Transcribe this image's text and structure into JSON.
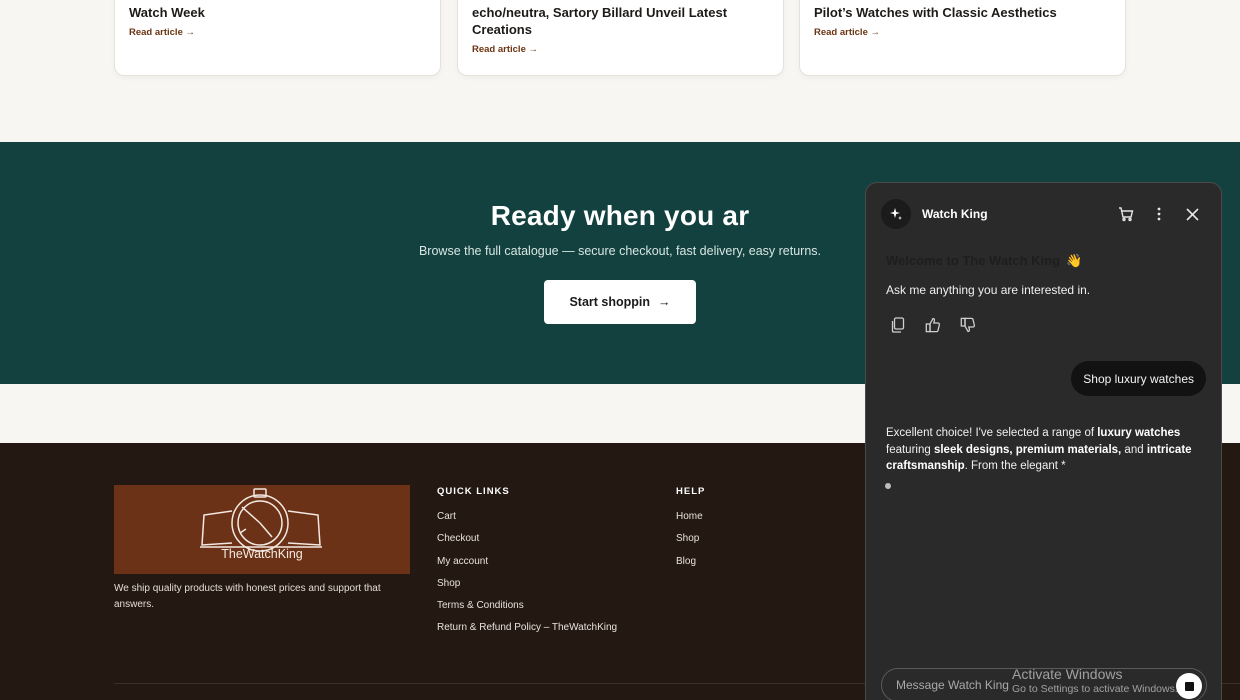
{
  "articles": [
    {
      "title_line1": "Watch Week",
      "title_line2": "",
      "link": "Read article",
      "arrow": "→"
    },
    {
      "title_line1": "echo/neutra, Sartory Billard Unveil Latest",
      "title_line2": "Creations",
      "link": "Read article",
      "arrow": "→"
    },
    {
      "title_line1": "Pilot’s Watches with Classic Aesthetics",
      "title_line2": "",
      "link": "Read article",
      "arrow": "→"
    }
  ],
  "cta": {
    "title": "Ready when you ar",
    "subtitle": "Browse the full catalogue — secure checkout, fast delivery, easy returns.",
    "button_label": "Start shoppin",
    "button_arrow": "→"
  },
  "footer": {
    "logo_text": "TheWatchKing",
    "about": "We ship quality products with honest prices and support that answers.",
    "quick_links": {
      "heading": "QUICK LINKS",
      "items": [
        "Cart",
        "Checkout",
        "My account",
        "Shop",
        "Terms & Conditions",
        "Return & Refund Policy – TheWatchKing"
      ]
    },
    "help": {
      "heading": "HELP",
      "items": [
        "Home",
        "Shop",
        "Blog"
      ]
    }
  },
  "chat": {
    "name": "Watch King",
    "welcome": "Welcome to The Watch King",
    "welcome_emoji": "👋",
    "ask": "Ask me anything you are interested in.",
    "user_message": "Shop luxury watches",
    "bot_message": {
      "p1": "Excellent choice! I've selected a range of ",
      "b1": "luxury watches",
      "p2": " featuring ",
      "b2": "sleek designs, premium materials,",
      "p3": " and ",
      "b3": "intricate craftsmanship",
      "p4": ". From the elegant *"
    },
    "input_placeholder": "Message Watch King",
    "icons": {
      "avatar": "sparkle-icon",
      "cart": "cart-icon",
      "menu": "more-vertical-icon",
      "close": "close-icon"
    }
  },
  "watermark": {
    "title": "Activate Windows",
    "subtitle": "Go to Settings to activate Windows."
  },
  "colors": {
    "cta_bg": "#12413f",
    "footer_bg": "#231812",
    "logo_bg": "#6b3218",
    "link": "#6b3413",
    "chat_bg": "#2a2a2a"
  }
}
